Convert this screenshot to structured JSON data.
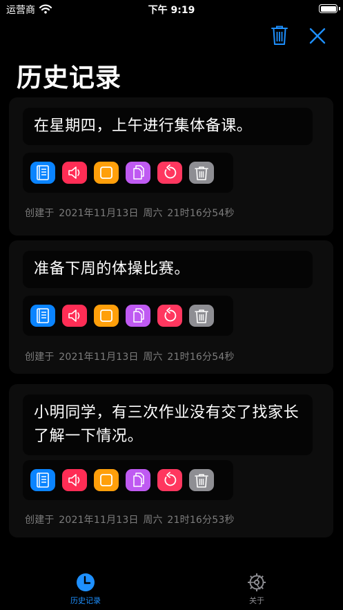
{
  "status_bar": {
    "carrier": "运营商",
    "time": "下午 9:19"
  },
  "header": {
    "title": "历史记录"
  },
  "colors": {
    "accent": "#1e90ff",
    "book": "#0a84ff",
    "speaker": "#ff2d55",
    "stop": "#ff9f0a",
    "copy": "#bf5af2",
    "replay": "#ff375f",
    "delete": "#8e8e93"
  },
  "records": [
    {
      "text": "在星期四，上午进行集体备课。",
      "created": "创建于 2021年11月13日 周六 21时16分54秒"
    },
    {
      "text": "准备下周的体操比赛。",
      "created": "创建于 2021年11月13日 周六 21时16分54秒"
    },
    {
      "text": "小明同学，有三次作业没有交了找家长了解一下情况。",
      "created": "创建于 2021年11月13日 周六 21时16分53秒"
    }
  ],
  "tabs": [
    {
      "label": "历史记录",
      "icon": "clock-icon",
      "active": true
    },
    {
      "label": "关于",
      "icon": "gear-icon",
      "active": false
    }
  ]
}
